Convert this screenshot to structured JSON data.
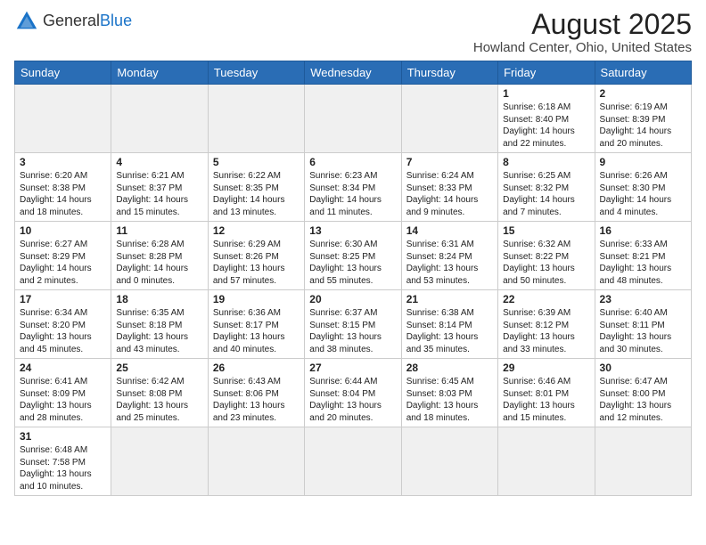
{
  "logo": {
    "text_general": "General",
    "text_blue": "Blue"
  },
  "header": {
    "title": "August 2025",
    "subtitle": "Howland Center, Ohio, United States"
  },
  "weekdays": [
    "Sunday",
    "Monday",
    "Tuesday",
    "Wednesday",
    "Thursday",
    "Friday",
    "Saturday"
  ],
  "weeks": [
    [
      {
        "day": "",
        "info": ""
      },
      {
        "day": "",
        "info": ""
      },
      {
        "day": "",
        "info": ""
      },
      {
        "day": "",
        "info": ""
      },
      {
        "day": "",
        "info": ""
      },
      {
        "day": "1",
        "info": "Sunrise: 6:18 AM\nSunset: 8:40 PM\nDaylight: 14 hours\nand 22 minutes."
      },
      {
        "day": "2",
        "info": "Sunrise: 6:19 AM\nSunset: 8:39 PM\nDaylight: 14 hours\nand 20 minutes."
      }
    ],
    [
      {
        "day": "3",
        "info": "Sunrise: 6:20 AM\nSunset: 8:38 PM\nDaylight: 14 hours\nand 18 minutes."
      },
      {
        "day": "4",
        "info": "Sunrise: 6:21 AM\nSunset: 8:37 PM\nDaylight: 14 hours\nand 15 minutes."
      },
      {
        "day": "5",
        "info": "Sunrise: 6:22 AM\nSunset: 8:35 PM\nDaylight: 14 hours\nand 13 minutes."
      },
      {
        "day": "6",
        "info": "Sunrise: 6:23 AM\nSunset: 8:34 PM\nDaylight: 14 hours\nand 11 minutes."
      },
      {
        "day": "7",
        "info": "Sunrise: 6:24 AM\nSunset: 8:33 PM\nDaylight: 14 hours\nand 9 minutes."
      },
      {
        "day": "8",
        "info": "Sunrise: 6:25 AM\nSunset: 8:32 PM\nDaylight: 14 hours\nand 7 minutes."
      },
      {
        "day": "9",
        "info": "Sunrise: 6:26 AM\nSunset: 8:30 PM\nDaylight: 14 hours\nand 4 minutes."
      }
    ],
    [
      {
        "day": "10",
        "info": "Sunrise: 6:27 AM\nSunset: 8:29 PM\nDaylight: 14 hours\nand 2 minutes."
      },
      {
        "day": "11",
        "info": "Sunrise: 6:28 AM\nSunset: 8:28 PM\nDaylight: 14 hours\nand 0 minutes."
      },
      {
        "day": "12",
        "info": "Sunrise: 6:29 AM\nSunset: 8:26 PM\nDaylight: 13 hours\nand 57 minutes."
      },
      {
        "day": "13",
        "info": "Sunrise: 6:30 AM\nSunset: 8:25 PM\nDaylight: 13 hours\nand 55 minutes."
      },
      {
        "day": "14",
        "info": "Sunrise: 6:31 AM\nSunset: 8:24 PM\nDaylight: 13 hours\nand 53 minutes."
      },
      {
        "day": "15",
        "info": "Sunrise: 6:32 AM\nSunset: 8:22 PM\nDaylight: 13 hours\nand 50 minutes."
      },
      {
        "day": "16",
        "info": "Sunrise: 6:33 AM\nSunset: 8:21 PM\nDaylight: 13 hours\nand 48 minutes."
      }
    ],
    [
      {
        "day": "17",
        "info": "Sunrise: 6:34 AM\nSunset: 8:20 PM\nDaylight: 13 hours\nand 45 minutes."
      },
      {
        "day": "18",
        "info": "Sunrise: 6:35 AM\nSunset: 8:18 PM\nDaylight: 13 hours\nand 43 minutes."
      },
      {
        "day": "19",
        "info": "Sunrise: 6:36 AM\nSunset: 8:17 PM\nDaylight: 13 hours\nand 40 minutes."
      },
      {
        "day": "20",
        "info": "Sunrise: 6:37 AM\nSunset: 8:15 PM\nDaylight: 13 hours\nand 38 minutes."
      },
      {
        "day": "21",
        "info": "Sunrise: 6:38 AM\nSunset: 8:14 PM\nDaylight: 13 hours\nand 35 minutes."
      },
      {
        "day": "22",
        "info": "Sunrise: 6:39 AM\nSunset: 8:12 PM\nDaylight: 13 hours\nand 33 minutes."
      },
      {
        "day": "23",
        "info": "Sunrise: 6:40 AM\nSunset: 8:11 PM\nDaylight: 13 hours\nand 30 minutes."
      }
    ],
    [
      {
        "day": "24",
        "info": "Sunrise: 6:41 AM\nSunset: 8:09 PM\nDaylight: 13 hours\nand 28 minutes."
      },
      {
        "day": "25",
        "info": "Sunrise: 6:42 AM\nSunset: 8:08 PM\nDaylight: 13 hours\nand 25 minutes."
      },
      {
        "day": "26",
        "info": "Sunrise: 6:43 AM\nSunset: 8:06 PM\nDaylight: 13 hours\nand 23 minutes."
      },
      {
        "day": "27",
        "info": "Sunrise: 6:44 AM\nSunset: 8:04 PM\nDaylight: 13 hours\nand 20 minutes."
      },
      {
        "day": "28",
        "info": "Sunrise: 6:45 AM\nSunset: 8:03 PM\nDaylight: 13 hours\nand 18 minutes."
      },
      {
        "day": "29",
        "info": "Sunrise: 6:46 AM\nSunset: 8:01 PM\nDaylight: 13 hours\nand 15 minutes."
      },
      {
        "day": "30",
        "info": "Sunrise: 6:47 AM\nSunset: 8:00 PM\nDaylight: 13 hours\nand 12 minutes."
      }
    ],
    [
      {
        "day": "31",
        "info": "Sunrise: 6:48 AM\nSunset: 7:58 PM\nDaylight: 13 hours\nand 10 minutes."
      },
      {
        "day": "",
        "info": ""
      },
      {
        "day": "",
        "info": ""
      },
      {
        "day": "",
        "info": ""
      },
      {
        "day": "",
        "info": ""
      },
      {
        "day": "",
        "info": ""
      },
      {
        "day": "",
        "info": ""
      }
    ]
  ]
}
